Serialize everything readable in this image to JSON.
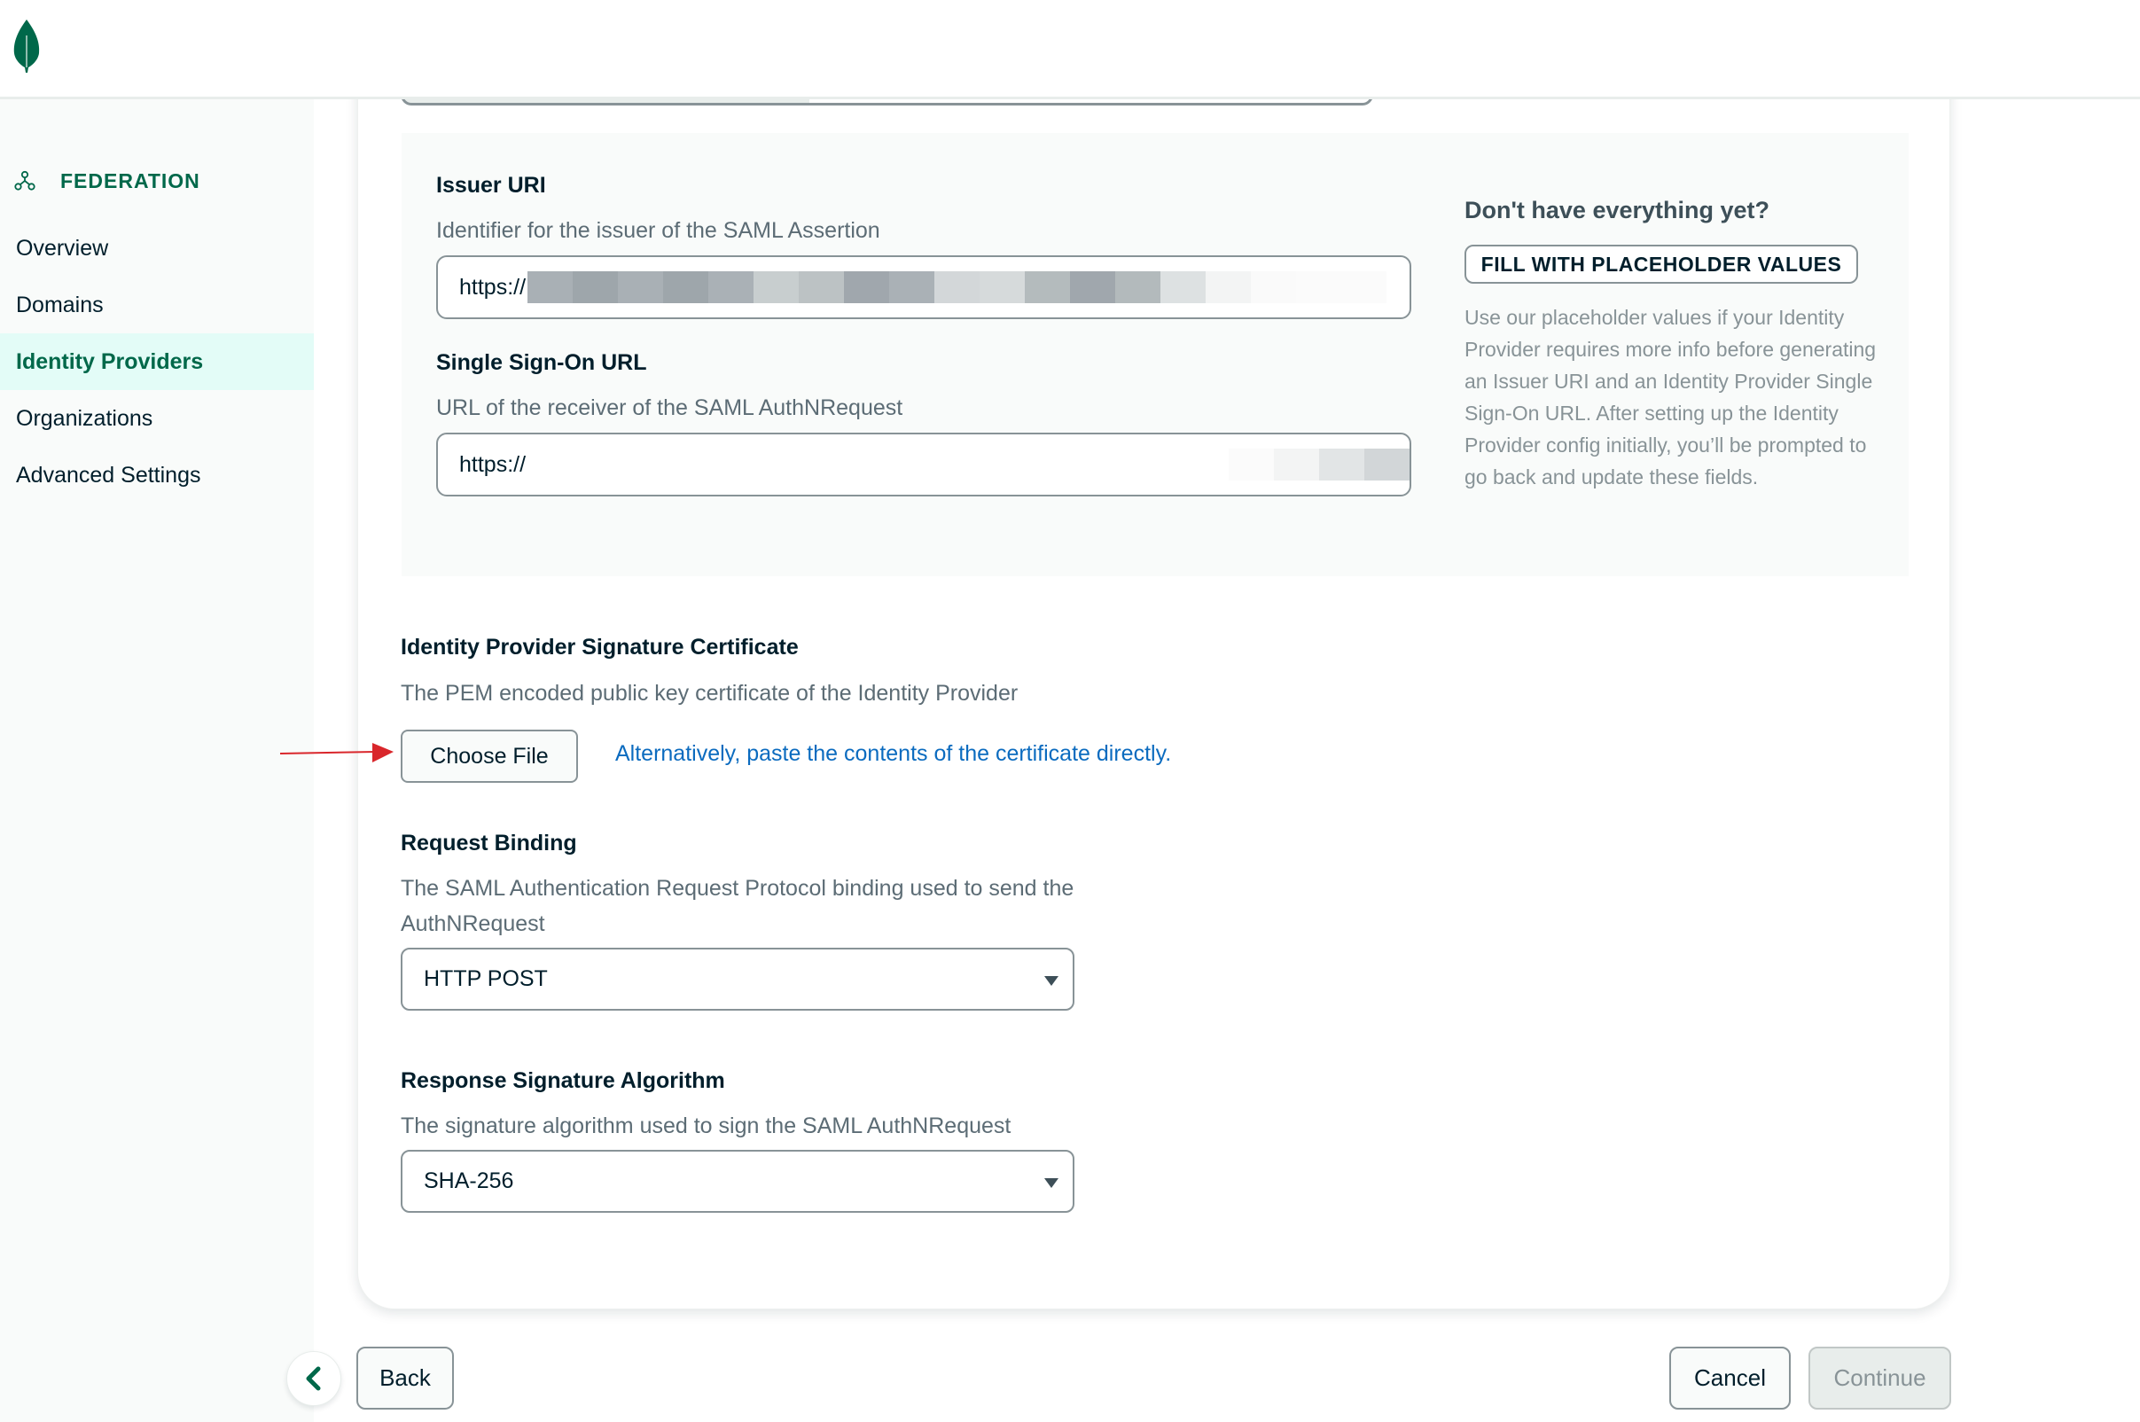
{
  "header": {
    "logo": "mongodb-leaf-logo"
  },
  "sidebar": {
    "section_icon": "federation-icon",
    "section_title": "FEDERATION",
    "items": [
      {
        "label": "Overview",
        "active": false
      },
      {
        "label": "Domains",
        "active": false
      },
      {
        "label": "Identity Providers",
        "active": true
      },
      {
        "label": "Organizations",
        "active": false
      },
      {
        "label": "Advanced Settings",
        "active": false
      }
    ]
  },
  "idp_urls": {
    "issuer_uri": {
      "label": "Issuer URI",
      "description": "Identifier for the issuer of the SAML Assertion",
      "value_prefix": "https://",
      "value_redacted": true
    },
    "sso_url": {
      "label": "Single Sign-On URL",
      "description": "URL of the receiver of the SAML AuthNRequest",
      "value_prefix": "https://",
      "value_redacted": true
    },
    "aside": {
      "title": "Don't have everything yet?",
      "fill_button": "FILL WITH PLACEHOLDER VALUES",
      "text": "Use our placeholder values if your Identity Provider requires more info before generating an Issuer URI and an Identity Provider Single Sign-On URL. After setting up the Identity Provider config initially, you’ll be prompted to go back and update these fields."
    }
  },
  "certificate": {
    "label": "Identity Provider Signature Certificate",
    "description": "The PEM encoded public key certificate of the Identity Provider",
    "choose_file": "Choose File",
    "paste_link": "Alternatively, paste the contents of the certificate directly.",
    "annotation": "red-arrow-pointing-to-choose-file"
  },
  "request_binding": {
    "label": "Request Binding",
    "description": "The SAML Authentication Request Protocol binding used to send the AuthNRequest",
    "selected": "HTTP POST"
  },
  "signature_algorithm": {
    "label": "Response Signature Algorithm",
    "description": "The signature algorithm used to sign the SAML AuthNRequest",
    "selected": "SHA-256"
  },
  "footer": {
    "collapse_icon": "chevron-left-icon",
    "back": "Back",
    "cancel": "Cancel",
    "continue": "Continue",
    "continue_disabled": true
  },
  "colors": {
    "brand_green": "#00684a",
    "active_bg": "#e3fcf7",
    "link_blue": "#0b6bbf",
    "annotation_red": "#d9262b"
  }
}
